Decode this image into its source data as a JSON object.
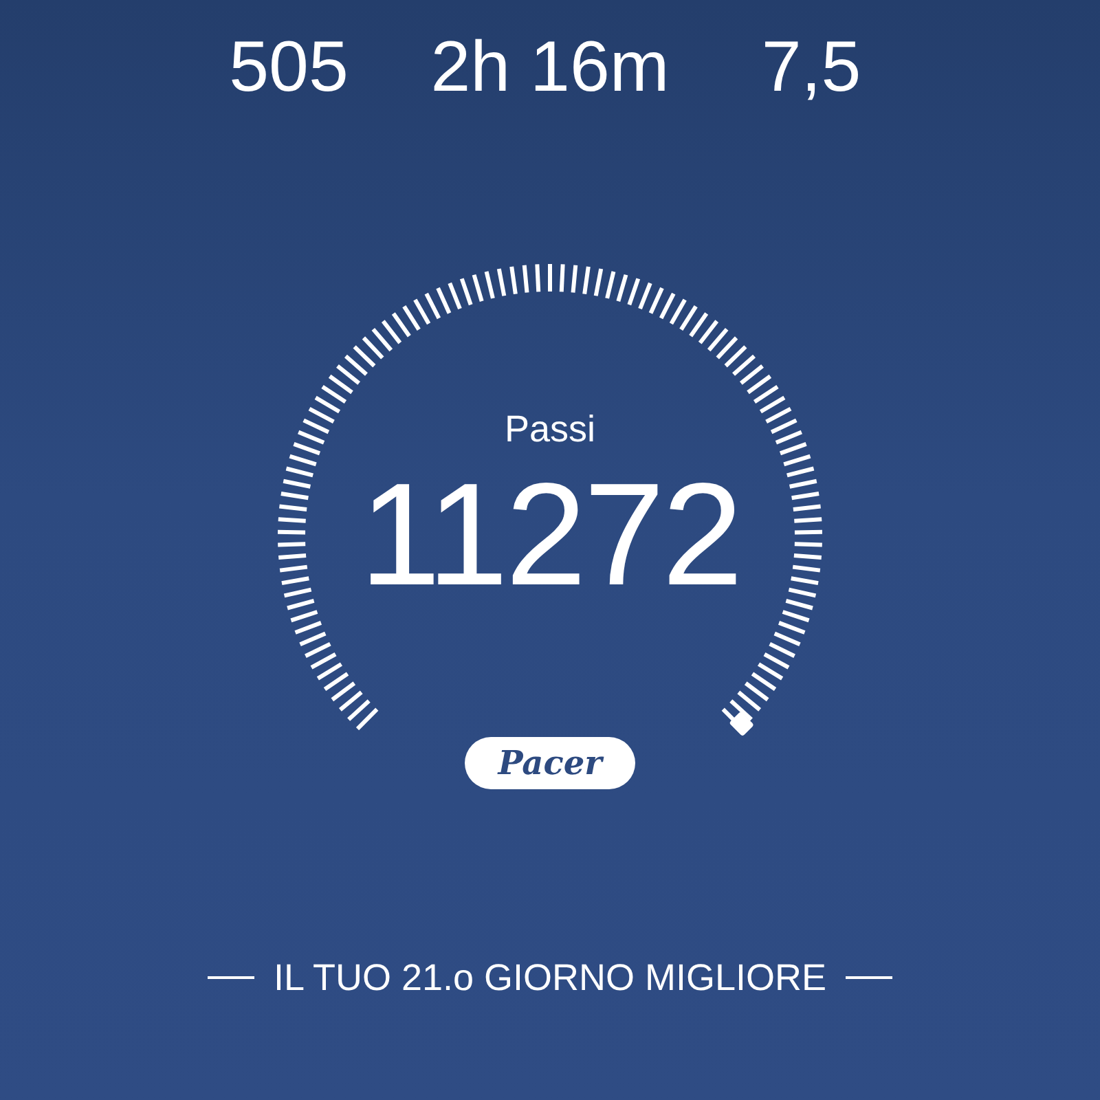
{
  "stats": [
    {
      "value": "505"
    },
    {
      "value": "2h 16m"
    },
    {
      "value": "7,5"
    }
  ],
  "gauge": {
    "label": "Passi",
    "value": "11272"
  },
  "logo": {
    "text": "Pacer"
  },
  "banner": {
    "text": "IL TUO 21.o GIORNO MIGLIORE"
  }
}
